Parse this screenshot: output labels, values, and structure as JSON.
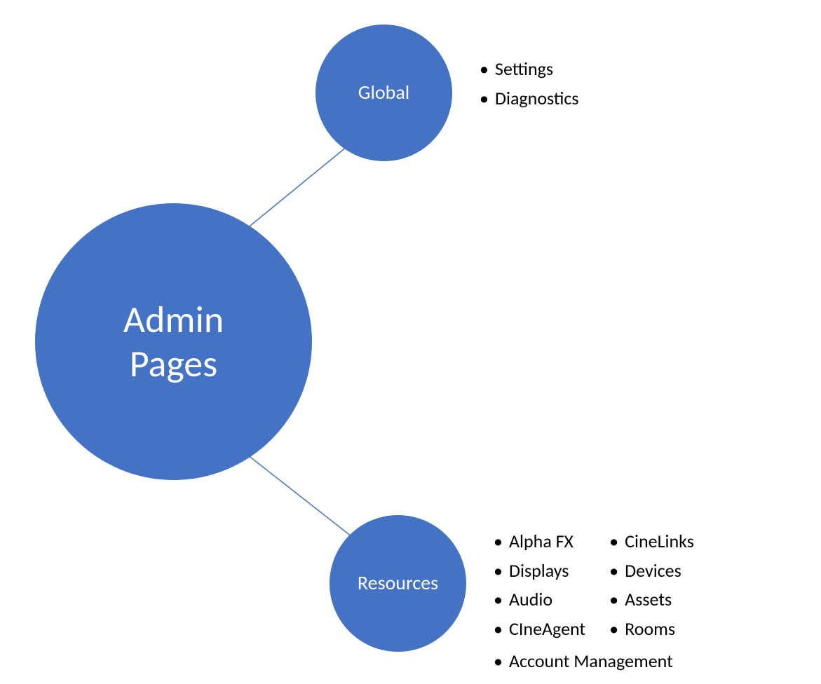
{
  "root": {
    "label": "Admin\nPages"
  },
  "nodes": {
    "global": {
      "label": "Global",
      "items": [
        "Settings",
        "Diagnostics"
      ]
    },
    "resources": {
      "label": "Resources",
      "col1": [
        "Alpha FX",
        "Displays",
        "Audio",
        "CIneAgent"
      ],
      "col2": [
        "CineLinks",
        "Devices",
        "Assets",
        "Rooms"
      ],
      "full": [
        "Account Management"
      ]
    }
  },
  "colors": {
    "node_fill": "#4472c4",
    "node_text": "#ffffff",
    "connector": "#4472c4",
    "body_text": "#000000"
  }
}
